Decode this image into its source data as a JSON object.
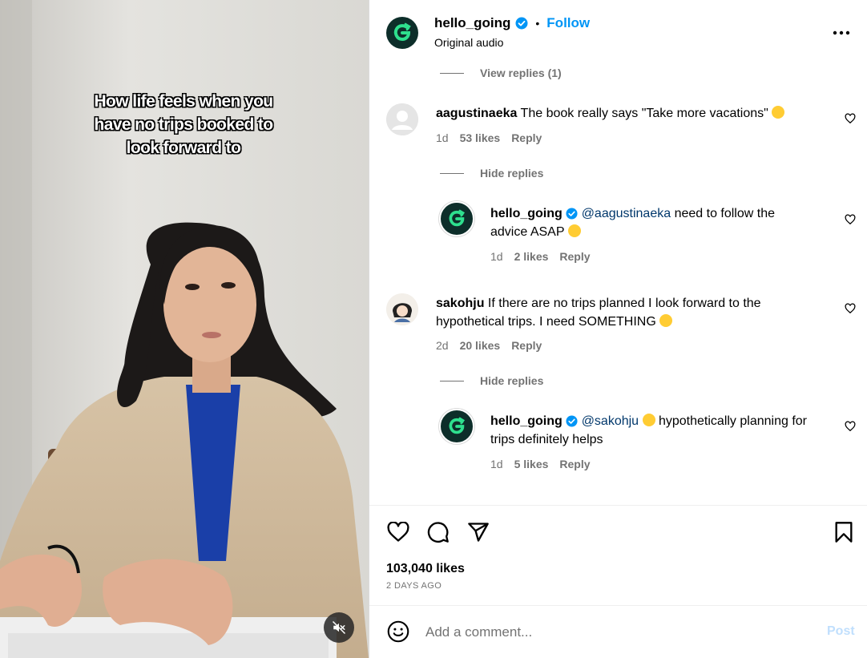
{
  "video": {
    "caption_lines": [
      "How life feels when you",
      "have no trips booked to",
      "look forward to"
    ],
    "mute_icon": "muted-speaker-icon"
  },
  "post_header": {
    "username": "hello_going",
    "verified": true,
    "separator": "•",
    "follow_label": "Follow",
    "subtitle": "Original audio",
    "more_icon": "more-options-icon"
  },
  "comments": {
    "view_replies_label": "View replies (1)",
    "items": [
      {
        "username": "aagustinaeka",
        "text": "The book really says \"Take more vacations\"",
        "age": "1d",
        "likes": "53 likes",
        "reply_label": "Reply",
        "toggle_label": "Hide replies",
        "reply": {
          "username": "hello_going",
          "mention": "@aagustinaeka",
          "text": "need to follow the advice ASAP",
          "age": "1d",
          "likes": "2 likes",
          "reply_label": "Reply"
        }
      },
      {
        "username": "sakohju",
        "text": "If there are no trips planned I look forward to the hypothetical trips. I need SOMETHING",
        "age": "2d",
        "likes": "20 likes",
        "reply_label": "Reply",
        "toggle_label": "Hide replies",
        "reply": {
          "username": "hello_going",
          "mention": "@sakohju",
          "text": "hypothetically planning for trips definitely helps",
          "age": "1d",
          "likes": "5 likes",
          "reply_label": "Reply"
        }
      }
    ]
  },
  "actions": {
    "likes_count": "103,040 likes",
    "posted": "2 DAYS AGO"
  },
  "comment_box": {
    "placeholder": "Add a comment...",
    "post_label": "Post"
  },
  "colors": {
    "accent": "#0095f6",
    "muted_text": "#737373",
    "brand_green": "#2ee08e",
    "brand_dark": "#0d2e2a"
  }
}
